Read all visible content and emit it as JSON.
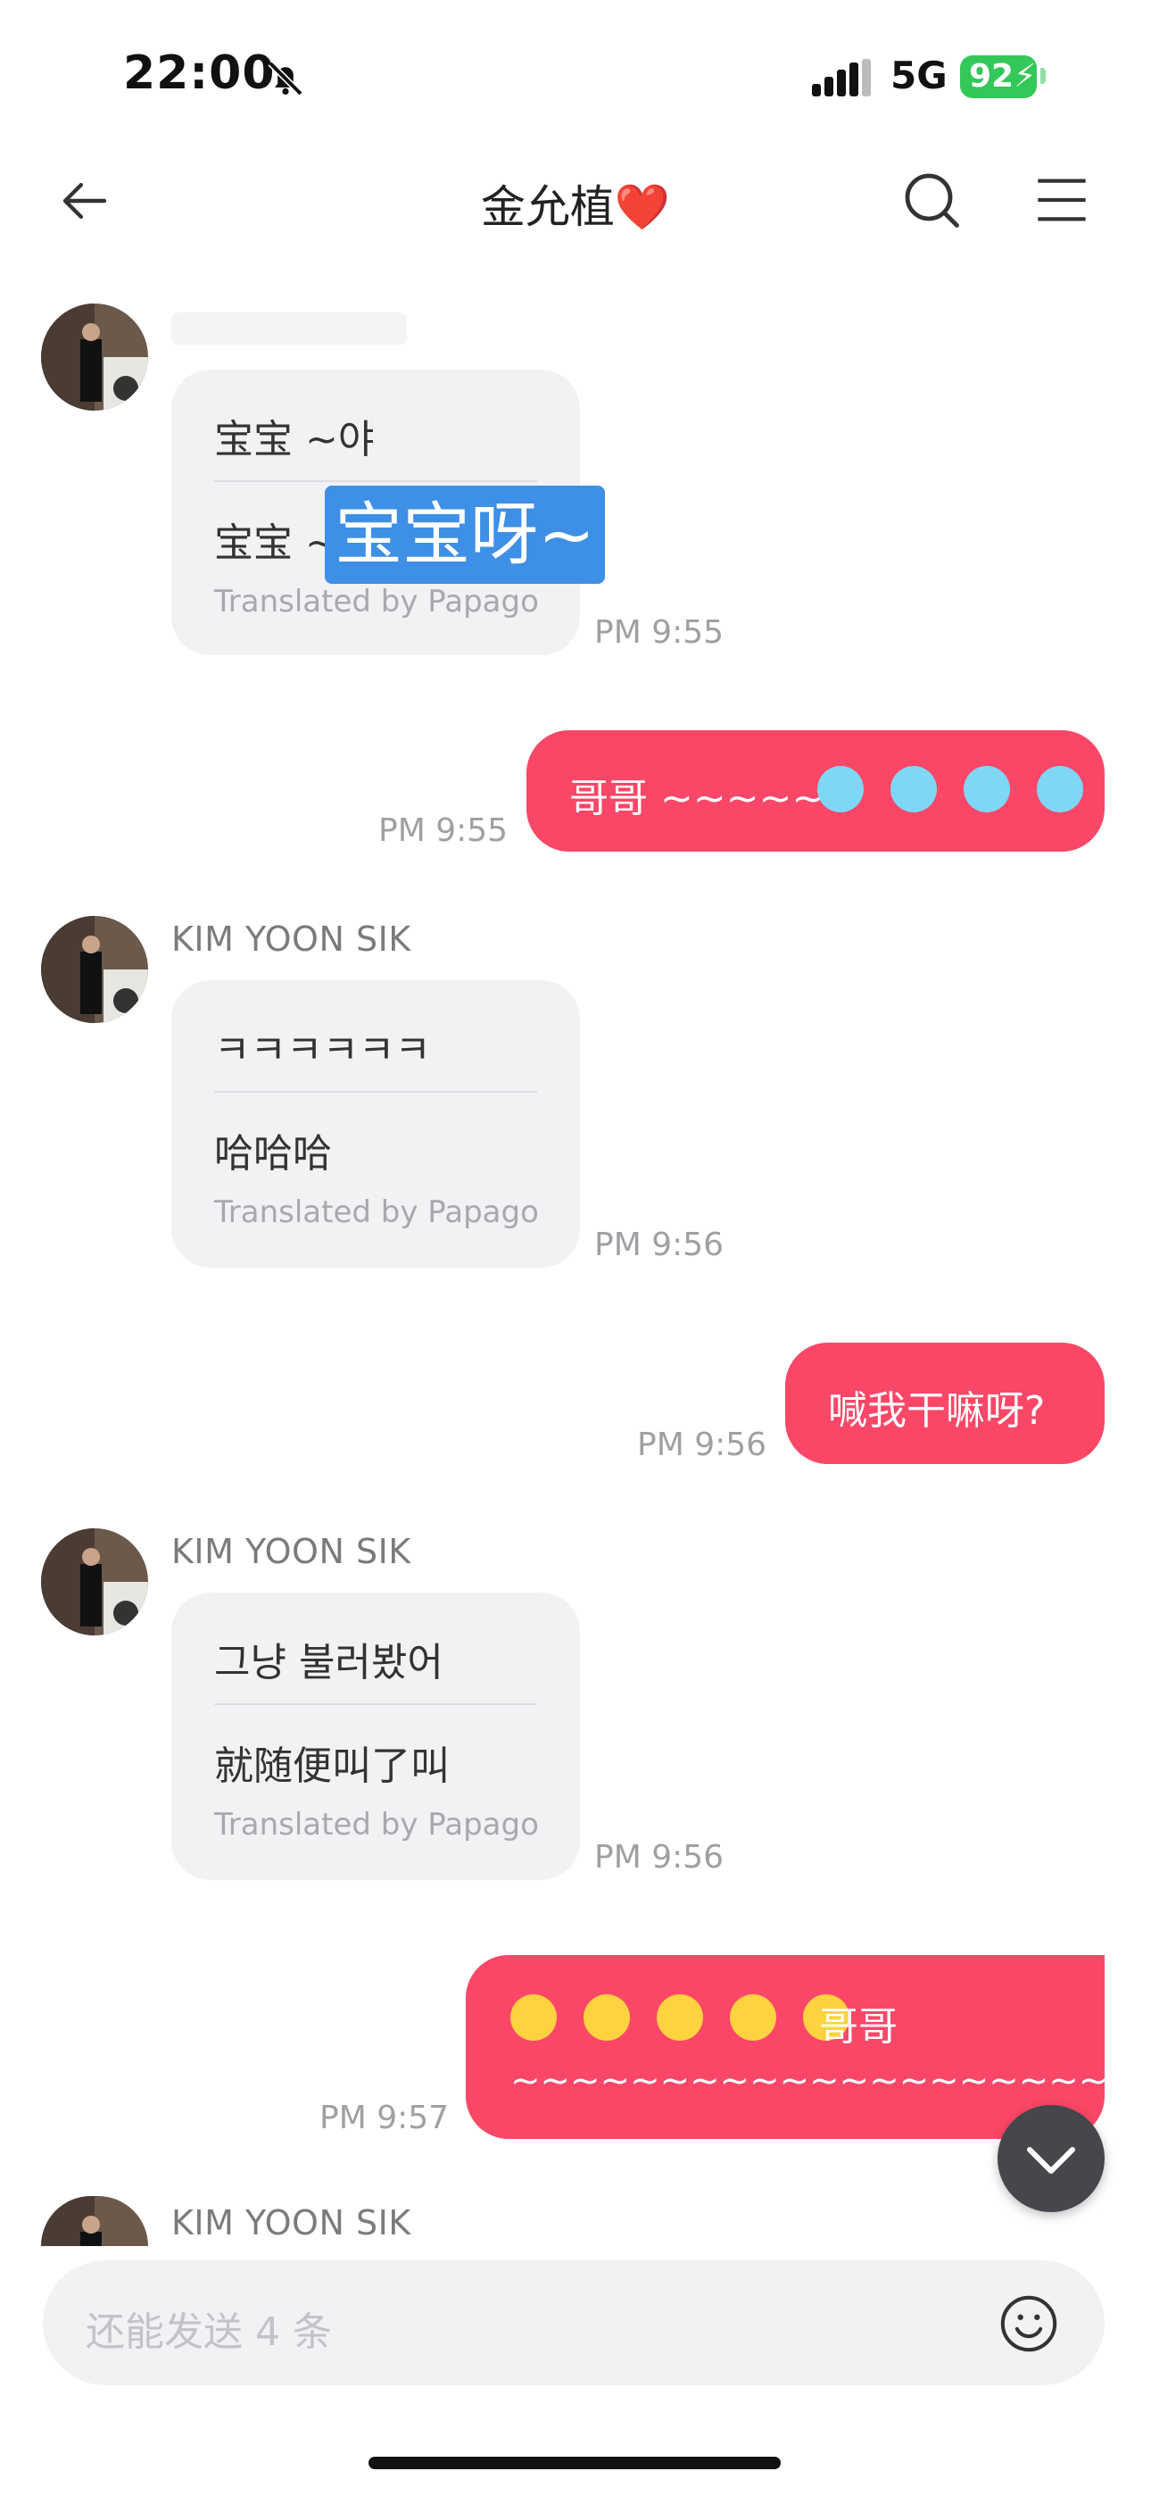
{
  "status_bar": {
    "time": "22:00",
    "network": "5G",
    "battery": "92"
  },
  "header": {
    "title": "金允植❤️"
  },
  "messages": [
    {
      "direction": "in",
      "original": "宝宝 ~야",
      "translation": "宝宝 ~",
      "highlight": "宝宝呀~",
      "translated_by": "Translated by Papago",
      "time": "PM 9:55"
    },
    {
      "direction": "out",
      "text": "哥哥 ~~~~~~",
      "time": "PM 9:55"
    },
    {
      "direction": "in",
      "sender": "KIM YOON SIK",
      "original": "ㅋㅋㅋㅋㅋㅋ",
      "translation": "哈哈哈",
      "translated_by": "Translated by Papago",
      "time": "PM 9:56"
    },
    {
      "direction": "out",
      "text": "喊我干嘛呀?",
      "time": "PM 9:56"
    },
    {
      "direction": "in",
      "sender": "KIM YOON SIK",
      "original": "그냥 불러봤어",
      "translation": "就随便叫了叫",
      "translated_by": "Translated by Papago",
      "time": "PM 9:56"
    },
    {
      "direction": "out",
      "text": "哥哥",
      "text2": "~~~~~~~~~~~~~~~~~~~~",
      "time": "PM 9:57"
    },
    {
      "direction": "in",
      "sender": "KIM YOON SIK"
    }
  ],
  "input": {
    "placeholder": "还能发送 4 条"
  },
  "colors": {
    "outgoing_bubble": "#fa4767",
    "incoming_bubble": "#f2f2f4",
    "highlight": "#3e8fe6"
  }
}
